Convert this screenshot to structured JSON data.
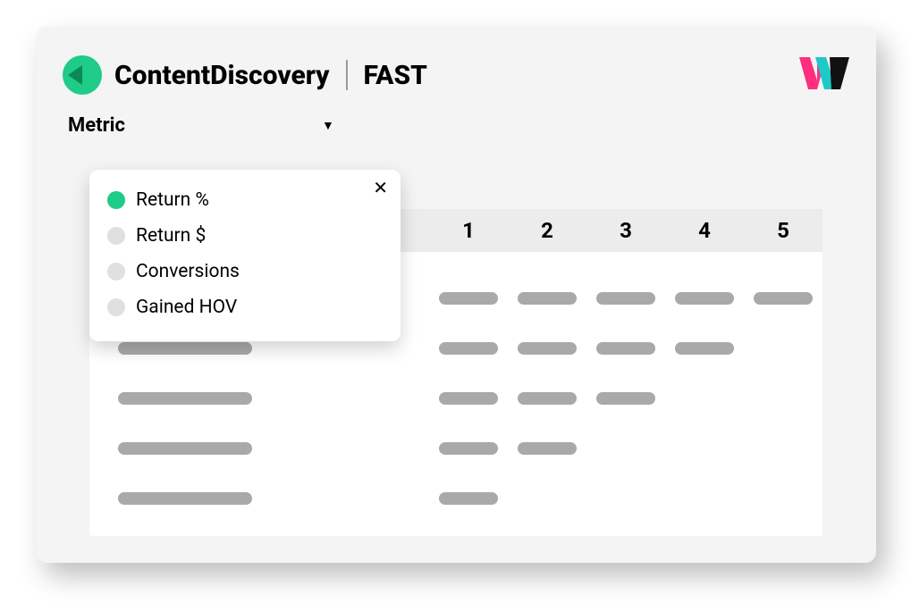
{
  "header": {
    "brand": "ContentDiscovery",
    "subbrand": "FAST"
  },
  "metric": {
    "label": "Metric"
  },
  "dropdown": {
    "options": [
      {
        "label": "Return %",
        "selected": true
      },
      {
        "label": "Return $",
        "selected": false
      },
      {
        "label": "Conversions",
        "selected": false
      },
      {
        "label": "Gained HOV",
        "selected": false
      }
    ]
  },
  "table": {
    "columns": [
      "1",
      "2",
      "3",
      "4",
      "5"
    ],
    "row_fill": [
      5,
      4,
      3,
      2,
      1
    ]
  }
}
